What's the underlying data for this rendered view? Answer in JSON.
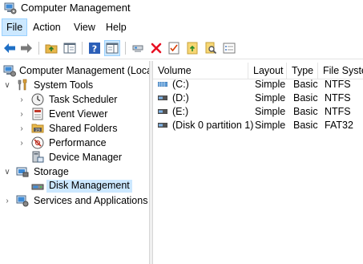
{
  "window": {
    "title": "Computer Management"
  },
  "menu": {
    "items": [
      "File",
      "Action",
      "View",
      "Help"
    ],
    "active_index": 0
  },
  "toolbar": {
    "buttons": [
      "back-arrow-icon",
      "forward-arrow-icon",
      "up-folder-icon",
      "show-hide-tree-icon",
      "help-icon",
      "action-pane-icon",
      "connect-icon",
      "delete-icon",
      "properties-icon",
      "open-icon",
      "search-icon",
      "new-list-icon"
    ]
  },
  "tree": {
    "root": "Computer Management (Local",
    "system_tools": "System Tools",
    "task_scheduler": "Task Scheduler",
    "event_viewer": "Event Viewer",
    "shared_folders": "Shared Folders",
    "performance": "Performance",
    "device_manager": "Device Manager",
    "storage": "Storage",
    "disk_management": "Disk Management",
    "services_apps": "Services and Applications"
  },
  "volumes": {
    "columns": [
      "Volume",
      "Layout",
      "Type",
      "File Syste"
    ],
    "rows": [
      {
        "volume": "(C:)",
        "layout": "Simple",
        "type": "Basic",
        "fs": "NTFS",
        "icon": "striped-drive-icon"
      },
      {
        "volume": "(D:)",
        "layout": "Simple",
        "type": "Basic",
        "fs": "NTFS",
        "icon": "drive-icon"
      },
      {
        "volume": "(E:)",
        "layout": "Simple",
        "type": "Basic",
        "fs": "NTFS",
        "icon": "drive-icon"
      },
      {
        "volume": "(Disk 0 partition 1)",
        "layout": "Simple",
        "type": "Basic",
        "fs": "FAT32",
        "icon": "drive-icon"
      }
    ]
  },
  "colors": {
    "selection": "#cce8ff",
    "selection_border": "#99d1ff",
    "delete_red": "#e81123",
    "accent_blue": "#1f6fc5"
  }
}
